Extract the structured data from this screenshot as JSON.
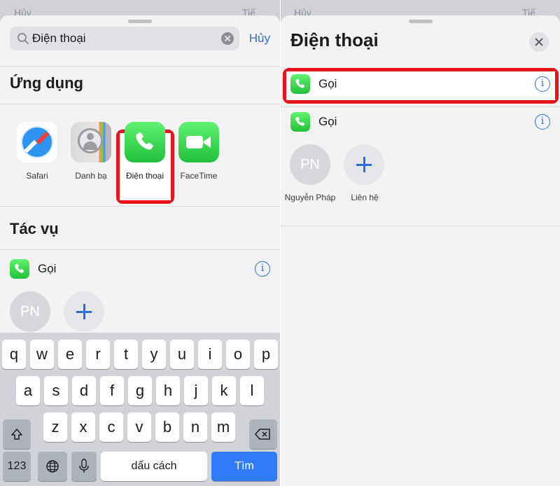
{
  "left": {
    "behind_left": "Hủy",
    "behind_right": "Tiế",
    "search": {
      "value": "Điện thoại",
      "cancel": "Hủy"
    },
    "apps_section": "Ứng dụng",
    "apps": [
      {
        "label": "Safari",
        "icon": "safari-icon"
      },
      {
        "label": "Danh bạ",
        "icon": "contacts-icon"
      },
      {
        "label": "Điện thoại",
        "icon": "phone-icon"
      },
      {
        "label": "FaceTime",
        "icon": "facetime-icon"
      }
    ],
    "actions_section": "Tác vụ",
    "action": {
      "label": "Gọi",
      "info": "i"
    },
    "contact_initials": "PN"
  },
  "keyboard": {
    "row1": [
      "q",
      "w",
      "e",
      "r",
      "t",
      "y",
      "u",
      "i",
      "o",
      "p"
    ],
    "row2": [
      "a",
      "s",
      "d",
      "f",
      "g",
      "h",
      "j",
      "k",
      "l"
    ],
    "row3": [
      "z",
      "x",
      "c",
      "v",
      "b",
      "n",
      "m"
    ],
    "numbers": "123",
    "space": "dấu cách",
    "search": "Tìm"
  },
  "right": {
    "behind_left": "Hủy",
    "behind_right": "Tiế",
    "title": "Điện thoại",
    "actions": [
      {
        "label": "Gọi",
        "info": "i"
      },
      {
        "label": "Gọi",
        "info": "i"
      }
    ],
    "contacts": [
      {
        "initials": "PN",
        "name": "Nguyễn Pháp"
      },
      {
        "name": "Liên hệ"
      }
    ]
  },
  "colors": {
    "highlight": "#e8141b",
    "accent": "#2f6ed6",
    "phone_green": "#22c13a"
  }
}
